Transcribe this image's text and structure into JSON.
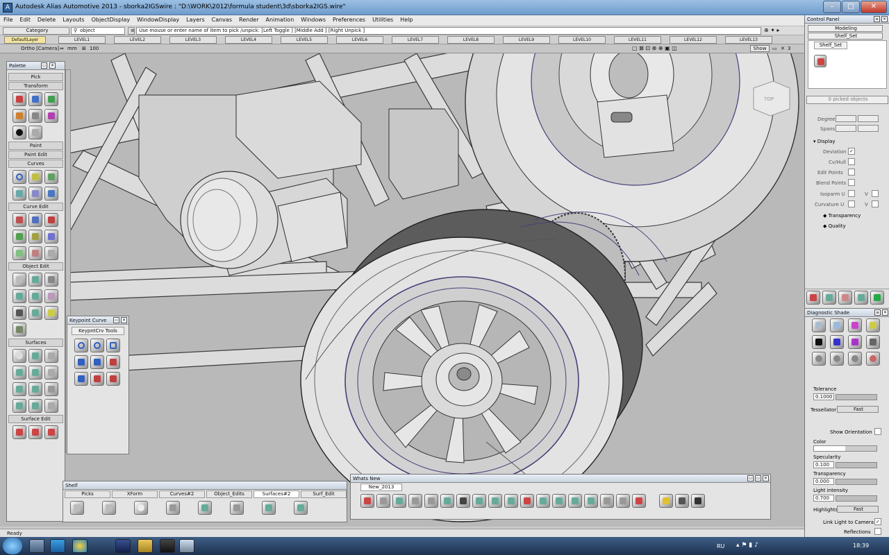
{
  "window": {
    "title": "Autodesk Alias Automotive 2013 - sborka2IGSwire : \"D:\\WORK\\2012\\formula student\\3d\\sborka2IGS.wire\""
  },
  "menu": [
    "File",
    "Edit",
    "Delete",
    "Layouts",
    "ObjectDisplay",
    "WindowDisplay",
    "Layers",
    "Canvas",
    "Render",
    "Animation",
    "Windows",
    "Preferences",
    "Utilities",
    "Help"
  ],
  "toolbar": {
    "category_label": "Category",
    "object_label": "object",
    "prompt": "Use mouse or enter name of item to pick /unpick: [Left Toggle ] [Middle Add ] [Right Unpick ]"
  },
  "layers": [
    "DefaultLayer",
    "LEVEL1",
    "LEVEL2",
    "LEVEL3",
    "LEVEL4",
    "LEVEL5",
    "LEVEL6",
    "LEVEL7",
    "LEVEL8",
    "LEVEL9",
    "LEVEL10",
    "LEVEL11",
    "LEVEL12",
    "LEVEL13"
  ],
  "viewport": {
    "label": "Ortho [Camera]",
    "units": "mm",
    "zoom": "100",
    "show_label": "Show",
    "page_number": "3",
    "viewcube": "TOP"
  },
  "palette": {
    "title": "Palette",
    "sections": [
      "Pick",
      "Transform",
      "Paint",
      "Paint Edit",
      "Curves",
      "Curve Edit",
      "Object Edit",
      "Surfaces",
      "Surface Edit"
    ]
  },
  "keypoint": {
    "title": "Keypoint Curve",
    "tab": "KeypntCrv Tools"
  },
  "shelf": {
    "title": "Shelf",
    "tabs": [
      "Picks",
      "XForm",
      "Curves#2",
      "Object_Edits",
      "Surfaces#2",
      "Surf_Edit"
    ]
  },
  "whatsnew": {
    "title": "Whats New",
    "tab": "New_2013"
  },
  "control_panel": {
    "title": "Control Panel",
    "mode": "Modeling",
    "shelf_set": "Shelf_Set",
    "shelf_tab": "Shelf_Set",
    "picked": "0 picked objects",
    "degree_label": "Degree",
    "spans_label": "Spans",
    "display_label": "Display",
    "display_items": [
      "Deviation",
      "Cv/Hull",
      "Edit Points",
      "Blend Points",
      "Isoparm U",
      "Curvature U"
    ],
    "v_label": "V",
    "transparency_label": "Transparency",
    "quality_label": "Quality"
  },
  "diag_shade": {
    "title": "Diagnostic Shade",
    "tolerance_label": "Tolerance",
    "tolerance_value": "0.1000",
    "tessellator_label": "Tessellator",
    "tessellator_value": "Fast",
    "show_orientation_label": "Show Orientation",
    "color_label": "Color",
    "specularity_label": "Specularity",
    "specularity_value": "0.100",
    "transparency_label": "Transparency",
    "transparency_value": "0.000",
    "light_label": "Light intensity",
    "light_value": "0.700",
    "highlights_label": "Highlights",
    "highlights_value": "Fast",
    "link_light_label": "Link Light to Camera",
    "reflections_label": "Reflections"
  },
  "status": "Ready",
  "taskbar": {
    "lang": "RU",
    "time": "18:39"
  }
}
